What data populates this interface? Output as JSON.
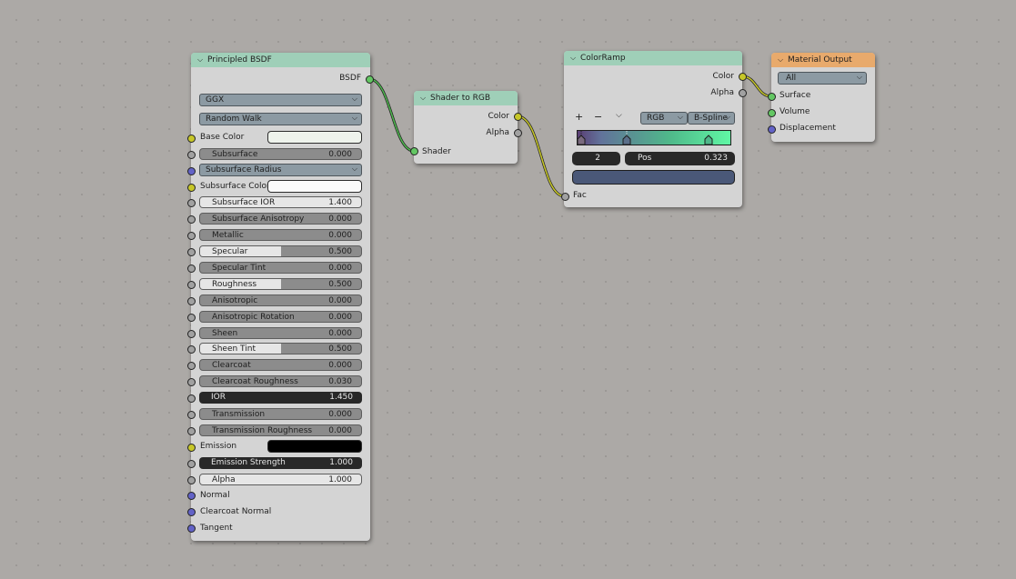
{
  "colors": {
    "shader_header": "#9fcfb8",
    "converter_header": "#9fcfb8",
    "output_header": "#e8aa6c",
    "socket_yellow": "#c7c729",
    "socket_green": "#63c763",
    "socket_grey": "#a1a1a1",
    "socket_blue": "#6363c7",
    "ramp_color": "#4a5878"
  },
  "principled": {
    "title": "Principled BSDF",
    "output_label": "BSDF",
    "distribution": "GGX",
    "subsurface_method": "Random Walk",
    "base_color_label": "Base Color",
    "base_color": "#eef3ec",
    "subsurface_label": "Subsurface",
    "subsurface_value": "0.000",
    "subsurface_radius_label": "Subsurface Radius",
    "subsurface_color_label": "Subsurface Color",
    "subsurface_color": "#fafafa",
    "subsurface_ior_label": "Subsurface IOR",
    "subsurface_ior_value": "1.400",
    "subsurface_aniso_label": "Subsurface Anisotropy",
    "subsurface_aniso_value": "0.000",
    "metallic_label": "Metallic",
    "metallic_value": "0.000",
    "specular_label": "Specular",
    "specular_value": "0.500",
    "specular_tint_label": "Specular Tint",
    "specular_tint_value": "0.000",
    "roughness_label": "Roughness",
    "roughness_value": "0.500",
    "anisotropic_label": "Anisotropic",
    "anisotropic_value": "0.000",
    "aniso_rot_label": "Anisotropic Rotation",
    "aniso_rot_value": "0.000",
    "sheen_label": "Sheen",
    "sheen_value": "0.000",
    "sheen_tint_label": "Sheen Tint",
    "sheen_tint_value": "0.500",
    "clearcoat_label": "Clearcoat",
    "clearcoat_value": "0.000",
    "clearcoat_rough_label": "Clearcoat Roughness",
    "clearcoat_rough_value": "0.030",
    "ior_label": "IOR",
    "ior_value": "1.450",
    "transmission_label": "Transmission",
    "transmission_value": "0.000",
    "trans_rough_label": "Transmission Roughness",
    "trans_rough_value": "0.000",
    "emission_label": "Emission",
    "emission_color": "#000000",
    "emission_strength_label": "Emission Strength",
    "emission_strength_value": "1.000",
    "alpha_label": "Alpha",
    "alpha_value": "1.000",
    "normal_label": "Normal",
    "clearcoat_normal_label": "Clearcoat Normal",
    "tangent_label": "Tangent"
  },
  "shader_to_rgb": {
    "title": "Shader to RGB",
    "color_label": "Color",
    "alpha_label": "Alpha",
    "shader_label": "Shader"
  },
  "colorramp": {
    "title": "ColorRamp",
    "color_label": "Color",
    "alpha_label": "Alpha",
    "add_symbol": "+",
    "remove_symbol": "−",
    "menu_symbol": "⌵",
    "color_mode": "RGB",
    "interpolation": "B-Spline",
    "active_index": "2",
    "pos_label": "Pos",
    "pos_value": "0.323",
    "fac_label": "Fac"
  },
  "material_output": {
    "title": "Material Output",
    "target": "All",
    "surface_label": "Surface",
    "volume_label": "Volume",
    "displacement_label": "Displacement"
  }
}
